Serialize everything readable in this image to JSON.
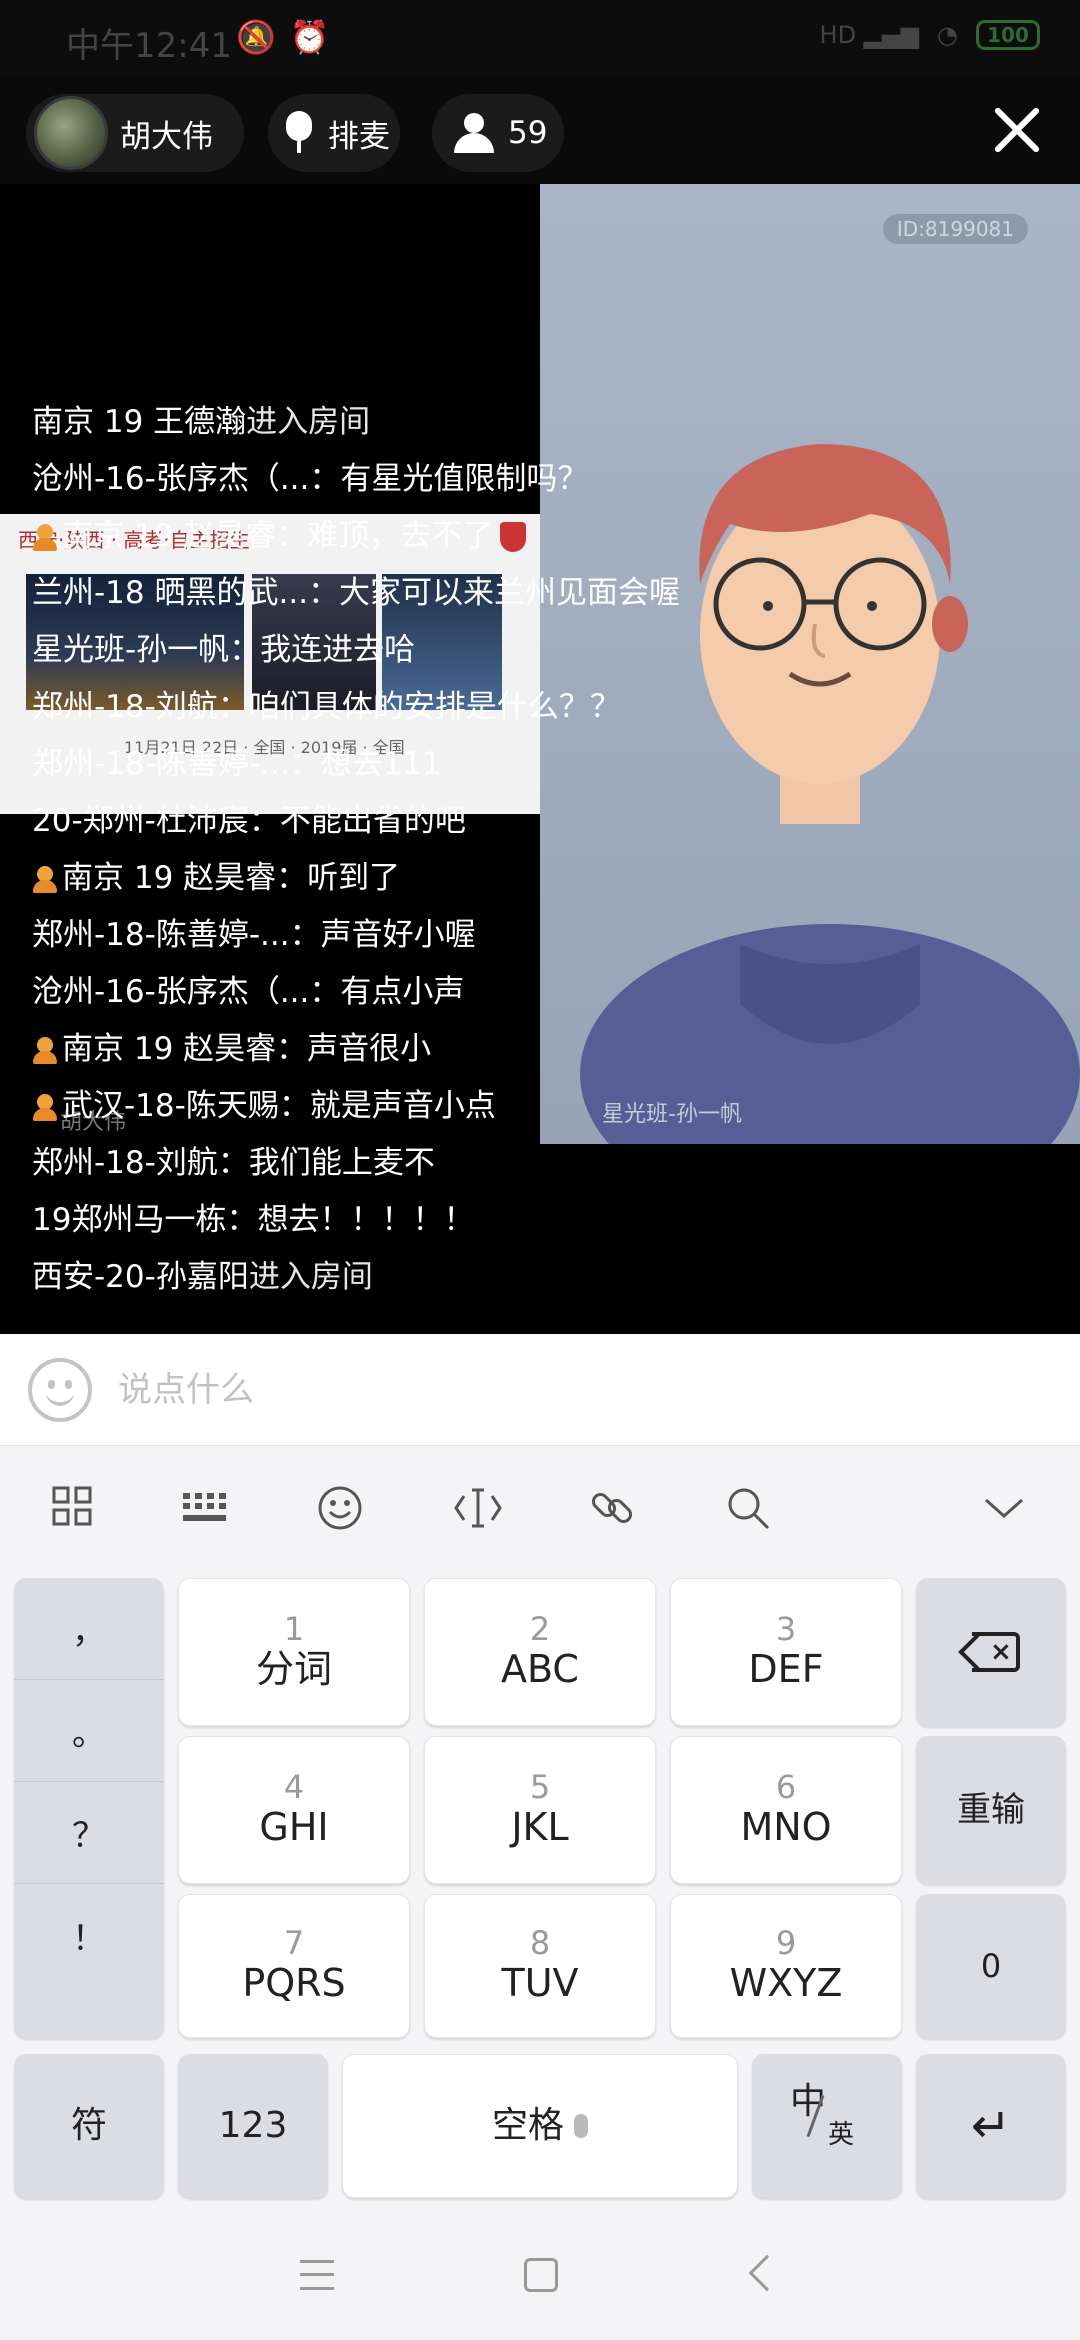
{
  "status_bar": {
    "time": "中午12:41",
    "icons": [
      "mute-icon",
      "alarm-icon"
    ],
    "signal_label": "HD",
    "battery": "100"
  },
  "header": {
    "host_name": "胡大伟",
    "mic_queue_label": "排麦",
    "viewer_count": "59"
  },
  "video": {
    "room_id": "ID:8199081",
    "caption": "星光班-孙一帆"
  },
  "slide": {
    "header_text": "西安·陕西 · 高考·自主招生",
    "footer_text": "11月21日 22日  · 全国 · 2019届 · 全国"
  },
  "host_watermark": "胡大伟",
  "chat": [
    {
      "name": "南京 19 王德瀚",
      "text": "进入房间",
      "system": true,
      "badge": false
    },
    {
      "name": "沧州-16-张序杰（...",
      "text": "：有星光值限制吗？",
      "system": false,
      "badge": false
    },
    {
      "name": "南京 19 赵昊睿",
      "text": "：难顶，去不了",
      "system": false,
      "badge": true
    },
    {
      "name": "兰州-18 晒黑的武...",
      "text": "：大家可以来兰州见面会喔",
      "system": false,
      "badge": false
    },
    {
      "name": "星光班-孙一帆",
      "text": "：我连进去哈",
      "system": false,
      "badge": false
    },
    {
      "name": "郑州-18-刘航",
      "text": "：咱们具体的安排是什么？？",
      "system": false,
      "badge": false
    },
    {
      "name": "郑州-18-陈善婷-...",
      "text": "：想去111",
      "system": false,
      "badge": false
    },
    {
      "name": "20-郑州-杜沛宸",
      "text": "：不能出省的吧",
      "system": false,
      "badge": false
    },
    {
      "name": "南京 19 赵昊睿",
      "text": "：听到了",
      "system": false,
      "badge": true
    },
    {
      "name": "郑州-18-陈善婷-...",
      "text": "：声音好小喔",
      "system": false,
      "badge": false
    },
    {
      "name": "沧州-16-张序杰（...",
      "text": "：有点小声",
      "system": false,
      "badge": false
    },
    {
      "name": "南京 19 赵昊睿",
      "text": "：声音很小",
      "system": false,
      "badge": true
    },
    {
      "name": "武汉-18-陈天赐",
      "text": "：就是声音小点",
      "system": false,
      "badge": true
    },
    {
      "name": "郑州-18-刘航",
      "text": "：我们能上麦不",
      "system": false,
      "badge": false
    },
    {
      "name": "19郑州马一栋",
      "text": "：想去！！！！！",
      "system": false,
      "badge": false
    },
    {
      "name": "西安-20-孙嘉阳",
      "text": "进入房间",
      "system": true,
      "badge": false
    }
  ],
  "input": {
    "placeholder": "说点什么"
  },
  "keyboard": {
    "toolbar_icons": [
      "apps-grid-icon",
      "keyboard-icon",
      "emoji-icon",
      "cursor-icon",
      "link-icon",
      "search-icon",
      "collapse-icon"
    ],
    "punctuation": [
      "，",
      "。",
      "？",
      "！"
    ],
    "keys": [
      {
        "num": "1",
        "label": "分词"
      },
      {
        "num": "2",
        "label": "ABC"
      },
      {
        "num": "3",
        "label": "DEF"
      },
      {
        "num": "4",
        "label": "GHI"
      },
      {
        "num": "5",
        "label": "JKL"
      },
      {
        "num": "6",
        "label": "MNO"
      },
      {
        "num": "7",
        "label": "PQRS"
      },
      {
        "num": "8",
        "label": "TUV"
      },
      {
        "num": "9",
        "label": "WXYZ"
      }
    ],
    "retype_label": "重输",
    "zero_label": "0",
    "symbol_label": "符",
    "numeric_label": "123",
    "space_label": "空格",
    "lang_top": "中",
    "lang_bottom": "英"
  }
}
